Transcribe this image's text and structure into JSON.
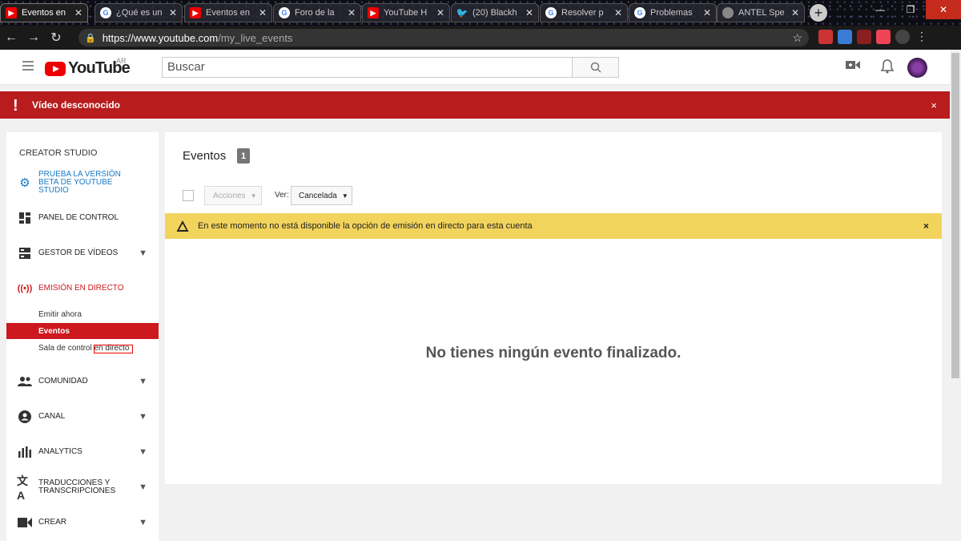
{
  "browser": {
    "tabs": [
      {
        "title": "Eventos en",
        "icon": "youtube-favicon",
        "active": true
      },
      {
        "title": "¿Qué es un",
        "icon": "google-favicon"
      },
      {
        "title": "Eventos en",
        "icon": "youtube-favicon"
      },
      {
        "title": "Foro de la",
        "icon": "google-favicon"
      },
      {
        "title": "YouTube H",
        "icon": "youtube-favicon"
      },
      {
        "title": "(20) Blackh",
        "icon": "twitter-favicon"
      },
      {
        "title": "Resolver p",
        "icon": "google-favicon"
      },
      {
        "title": "Problemas",
        "icon": "google-favicon"
      },
      {
        "title": "ANTEL Spe",
        "icon": "globe-favicon"
      }
    ],
    "url_host": "https://www.youtube.com",
    "url_path": "/my_live_events"
  },
  "header": {
    "logo_text": "YouTube",
    "region": "AR",
    "search_placeholder": "Buscar"
  },
  "banner": {
    "message": "Vídeo desconocido",
    "close": "×",
    "color": "#b81c1c"
  },
  "sidebar": {
    "title": "CREATOR STUDIO",
    "items": [
      {
        "label": "PRUEBA LA VERSIÓN BETA DE YOUTUBE STUDIO",
        "icon": "gear-icon"
      },
      {
        "label": "PANEL DE CONTROL",
        "icon": "dashboard-icon"
      },
      {
        "label": "GESTOR DE VÍDEOS",
        "icon": "video-manager-icon"
      },
      {
        "label": "EMISIÓN EN DIRECTO",
        "icon": "live-broadcast-icon"
      },
      {
        "label": "COMUNIDAD",
        "icon": "community-icon"
      },
      {
        "label": "CANAL",
        "icon": "channel-icon"
      },
      {
        "label": "ANALYTICS",
        "icon": "analytics-icon"
      },
      {
        "label": "TRADUCCIONES Y TRANSCRIPCIONES",
        "icon": "translate-icon"
      },
      {
        "label": "CREAR",
        "icon": "create-icon"
      }
    ],
    "live_subitems": [
      "Emitir ahora",
      "Eventos",
      "Sala de control en directo"
    ]
  },
  "main": {
    "title": "Eventos",
    "count": "1",
    "actions_label": "Acciones",
    "view_label": "Ver:",
    "view_value": "Cancelada",
    "warning": "En este momento no está disponible la opción de emisión en directo para esta cuenta",
    "warning_close": "×",
    "empty_message": "No tienes ningún evento finalizado.",
    "warning_color": "#f2d45c"
  }
}
